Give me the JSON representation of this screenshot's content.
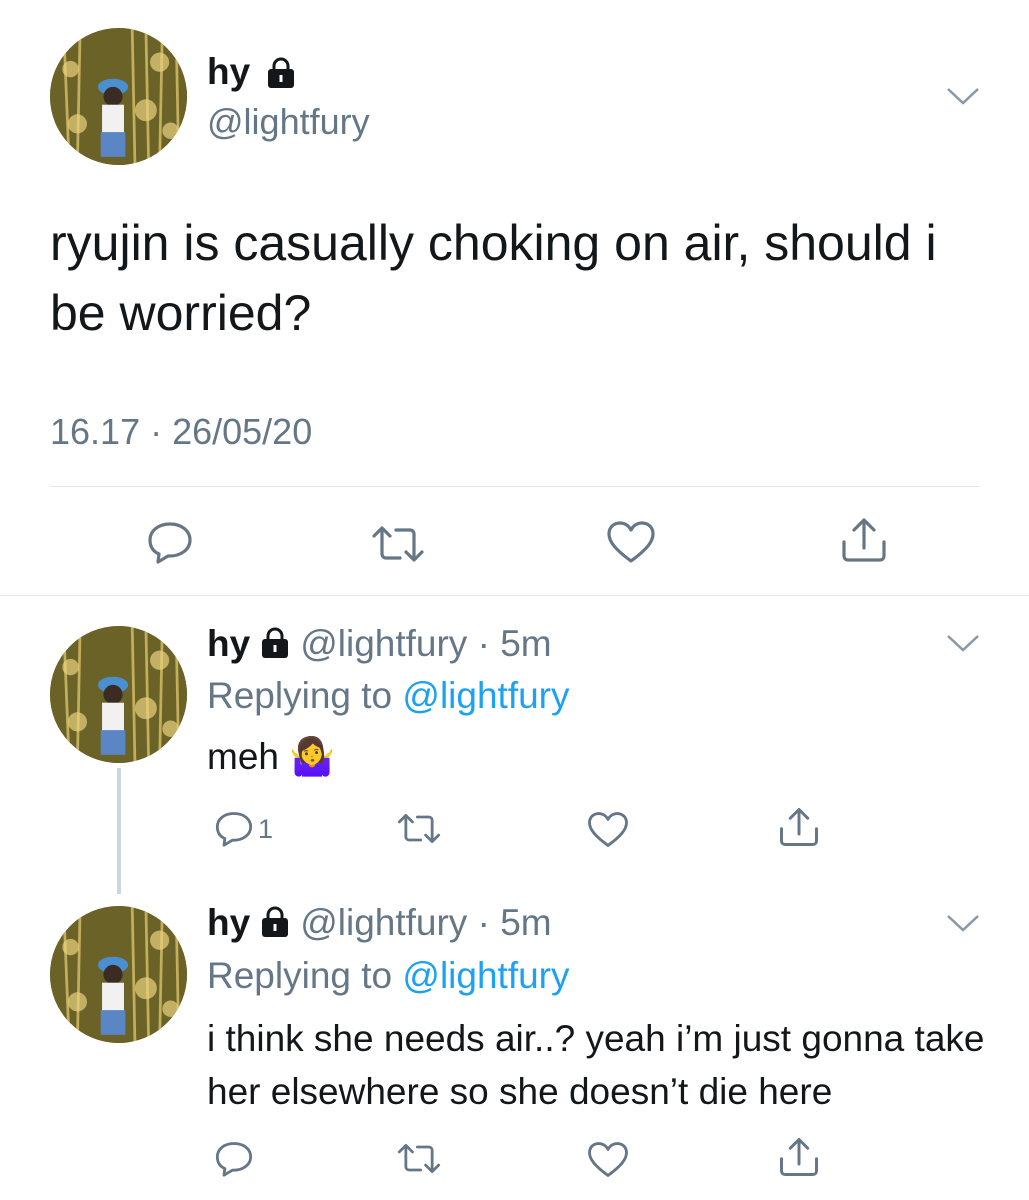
{
  "main_tweet": {
    "display_name": "hy",
    "handle": "@lightfury",
    "text": "ryujin is casually choking on air, should i be worried?",
    "timestamp": "16.17 · 26/05/20",
    "icons": [
      "lock-icon",
      "chevron-down-icon",
      "reply-icon",
      "retweet-icon",
      "like-icon",
      "share-icon"
    ]
  },
  "replies": [
    {
      "display_name": "hy",
      "handle": "@lightfury",
      "time": "5m",
      "replying_prefix": "Replying to ",
      "replying_to": "@lightfury",
      "text": "meh 🤷‍♀️",
      "reply_count": "1"
    },
    {
      "display_name": "hy",
      "handle": "@lightfury",
      "time": "5m",
      "replying_prefix": "Replying to ",
      "replying_to": "@lightfury",
      "text": "i think she needs air..? yeah i’m just gonna take her elsewhere so she doesn’t die here",
      "reply_count": ""
    }
  ],
  "colors": {
    "text": "#14171a",
    "secondary": "#657786",
    "link": "#1da1f2",
    "divider": "#e1e8ed"
  }
}
